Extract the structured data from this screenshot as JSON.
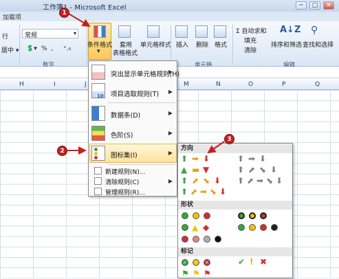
{
  "window": {
    "title": "工作簿1 - Microsoft Excel",
    "controls": [
      "─",
      "□",
      "✕"
    ]
  },
  "tabs": {
    "addin": "加载项"
  },
  "ribbon": {
    "left_labels": [
      "行",
      "居中 ▾"
    ],
    "number_format": "常规",
    "number_group": "数字",
    "conditional_format": "条件格式",
    "table_format_line1": "套用",
    "table_format_line2": "表格格式",
    "cell_styles": "单元格样式",
    "insert": "插入",
    "delete": "删除",
    "format": "格式",
    "cells_group": "单元格",
    "autosum": "Σ 自动求和",
    "fill": "填充",
    "clear": "清除",
    "sort_filter": "排序和筛选",
    "find_select": "查找和选择",
    "editing_group": "编辑",
    "percent": "%",
    "comma": ","
  },
  "columns": [
    "H",
    "I",
    "J",
    "M",
    "N",
    "O",
    "P",
    "Q"
  ],
  "menu": {
    "items": [
      {
        "label": "突出显示单元格规则(H)",
        "icon": "highlight-cells-icon"
      },
      {
        "label": "项目选取规则(T)",
        "icon": "top-bottom-rules-icon"
      },
      {
        "label": "数据条(D)",
        "icon": "data-bars-icon"
      },
      {
        "label": "色阶(S)",
        "icon": "color-scales-icon"
      },
      {
        "label": "图标集(I)",
        "icon": "icon-sets-icon"
      }
    ],
    "small_items": [
      {
        "label": "新建规则(N)..."
      },
      {
        "label": "清除规则(C)"
      },
      {
        "label": "管理规则(R)..."
      }
    ],
    "top_labels": [
      "10"
    ]
  },
  "gallery": {
    "sections": [
      "方向",
      "形状",
      "标记"
    ]
  },
  "callouts": [
    "1",
    "2",
    "3"
  ],
  "colors": {
    "accent_red": "#c42020",
    "green": "#3aa53a",
    "yellow": "#f2c200",
    "red": "#d03030",
    "gray": "#808080"
  }
}
